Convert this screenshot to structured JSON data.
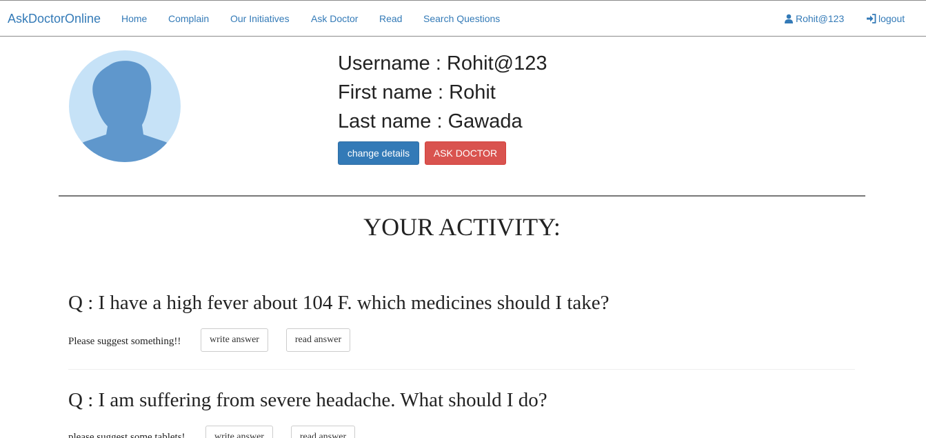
{
  "navbar": {
    "brand": "AskDoctorOnline",
    "items": [
      "Home",
      "Complain",
      "Our Initiatives",
      "Ask Doctor",
      "Read",
      "Search Questions"
    ],
    "user_label": "Rohit@123",
    "logout_label": "logout"
  },
  "profile": {
    "username_line": "Username : Rohit@123",
    "first_name_line": "First name : Rohit",
    "last_name_line": "Last name : Gawada",
    "change_details_label": "change details",
    "ask_doctor_label": "ASK DOCTOR",
    "colors": {
      "primary": "#337ab7",
      "danger": "#d9534f",
      "avatar_bg": "#c6e2f7",
      "avatar_fg": "#5f97cc"
    }
  },
  "activity": {
    "title": "YOUR ACTIVITY:",
    "questions": [
      {
        "question": "Q : I have a high fever about 104 F. which medicines should I take?",
        "description": "Please suggest something!!",
        "write_label": "write answer",
        "read_label": "read answer"
      },
      {
        "question": "Q : I am suffering from severe headache. What should I do?",
        "description": "please suggest some tablets!",
        "write_label": "write answer",
        "read_label": "read answer"
      }
    ]
  },
  "icons": {
    "user": "user-icon",
    "logout": "logout-icon",
    "avatar": "avatar-silhouette"
  }
}
